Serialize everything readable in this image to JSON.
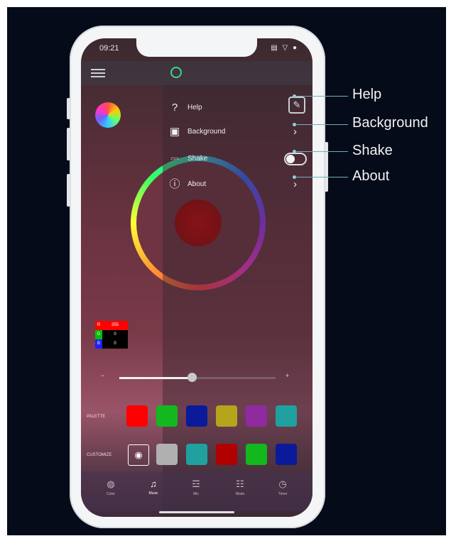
{
  "status": {
    "time": "09:21",
    "icons": "▤ ▽ ●"
  },
  "menu": {
    "items": [
      {
        "label": "Help",
        "icon": "question-icon",
        "glyph": "?"
      },
      {
        "label": "Background",
        "icon": "image-icon",
        "glyph": "▣"
      },
      {
        "label": "Shake",
        "icon": "shake-icon",
        "glyph": "⎓"
      },
      {
        "label": "About",
        "icon": "info-icon",
        "glyph": "ⓘ"
      }
    ],
    "shake_toggle_on": false
  },
  "rgb_box": {
    "r_label": "R",
    "r_value": "255",
    "g_label": "G",
    "g_value": "0",
    "b_label": "B",
    "b_value": "0"
  },
  "slider": {
    "min_label": "−",
    "max_label": "+",
    "level": 0.45
  },
  "palette": {
    "label": "PALETTE",
    "colors": [
      "#ff0000",
      "#12b81e",
      "#0a1a9a",
      "#b5a51a",
      "#8f2aa0",
      "#21a0a0"
    ]
  },
  "custom": {
    "label": "CUSTOMIZE",
    "colors": [
      "#b0b0b0",
      "#21a0a0",
      "#b00000",
      "#12b81e",
      "#0a1a9a"
    ]
  },
  "tabs": [
    {
      "label": "Color",
      "icon": "palette-icon",
      "glyph": "◍"
    },
    {
      "label": "Music",
      "icon": "music-icon",
      "glyph": "♫"
    },
    {
      "label": "Mic",
      "icon": "mic-icon",
      "glyph": "☲"
    },
    {
      "label": "Mode",
      "icon": "mode-icon",
      "glyph": "☷"
    },
    {
      "label": "Timer",
      "icon": "timer-icon",
      "glyph": "◷"
    }
  ],
  "callouts": {
    "help": "Help",
    "background": "Background",
    "shake": "Shake",
    "about": "About"
  },
  "colors": {
    "accent_green": "#3fd58a",
    "callout_teal": "#6fb0b8",
    "background_navy": "#050b18"
  }
}
